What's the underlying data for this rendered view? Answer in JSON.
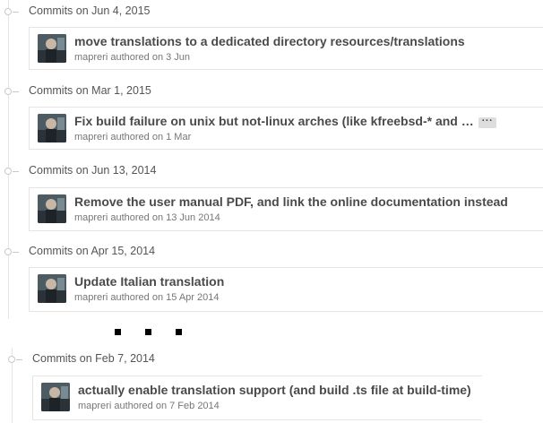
{
  "groups": [
    {
      "header": "Commits on Jun 4, 2015",
      "title": "move translations to a dedicated directory resources/translations",
      "author": "mapreri",
      "authored_text": "authored on 3 Jun",
      "has_ellipsis": false
    },
    {
      "header": "Commits on Mar 1, 2015",
      "title": "Fix build failure on unix but not-linux arches (like kfreebsd-* and h…",
      "author": "mapreri",
      "authored_text": "authored on 1 Mar",
      "has_ellipsis": true,
      "ellipsis_label": "···"
    },
    {
      "header": "Commits on Jun 13, 2014",
      "title": "Remove the user manual PDF, and link the online documentation instead",
      "author": "mapreri",
      "authored_text": "authored on 13 Jun 2014",
      "has_ellipsis": false
    },
    {
      "header": "Commits on Apr 15, 2014",
      "title": "Update Italian translation",
      "author": "mapreri",
      "authored_text": "authored on 15 Apr 2014",
      "has_ellipsis": false
    },
    {
      "header": "Commits on Feb 7, 2014",
      "title": "actually enable translation support (and build .ts file at build-time)",
      "author": "mapreri",
      "authored_text": "authored on 7 Feb 2014",
      "has_ellipsis": false
    }
  ],
  "colors": {
    "timeline": "#e5e5e5",
    "title_text": "#4a4a4a",
    "meta_text": "#767676"
  },
  "icons": {
    "commit_node": "commit-node-icon",
    "avatar": "user-avatar",
    "more": "ellipsis-icon"
  }
}
